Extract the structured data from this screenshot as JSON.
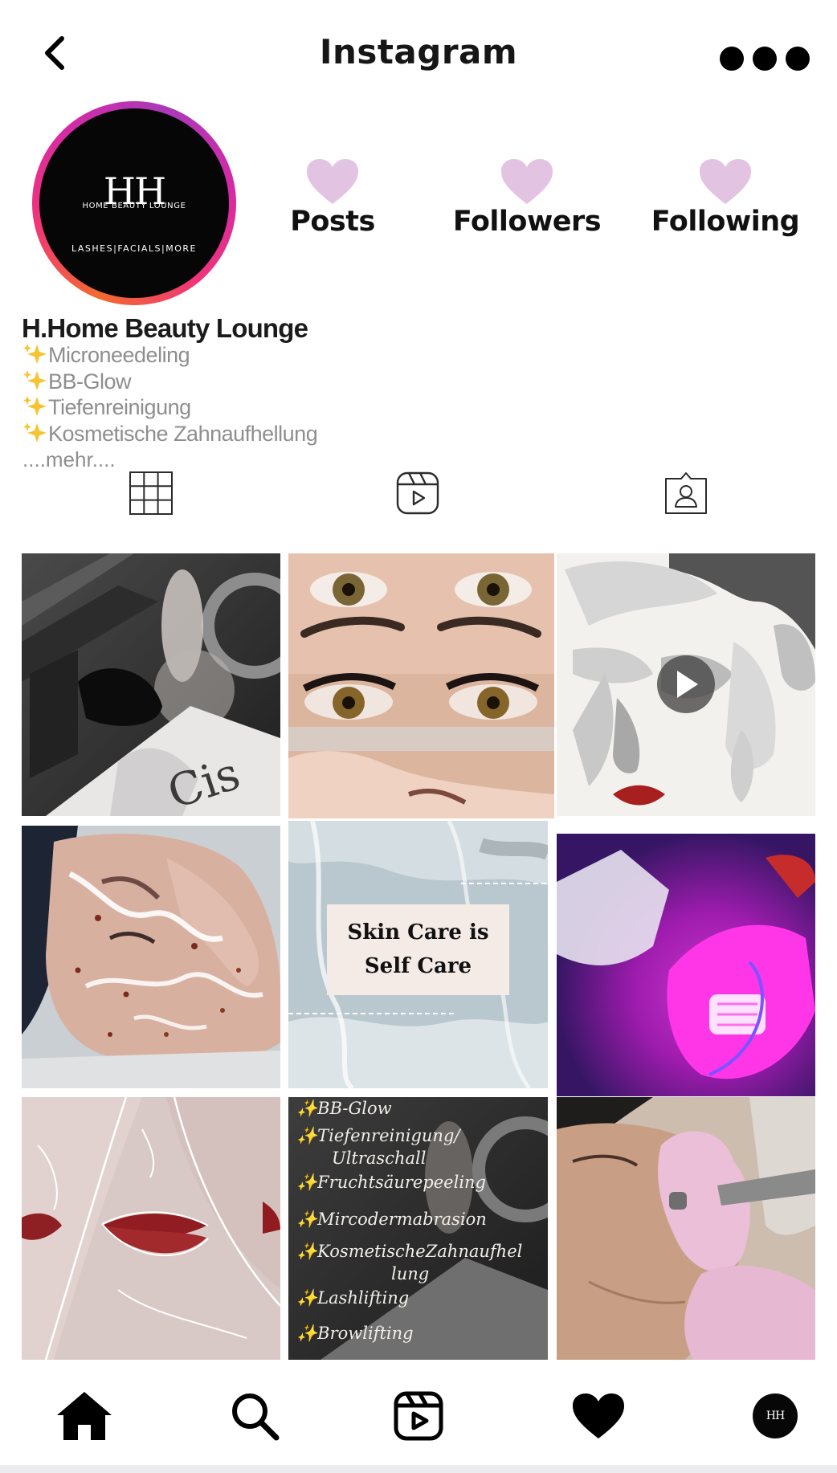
{
  "header": {
    "title": "Instagram",
    "back_icon": "chevron-left-icon",
    "more_icon": "more-dots-icon"
  },
  "profile": {
    "name": "H.Home Beauty Lounge",
    "avatar_logo": {
      "monogram": "HH",
      "line1": "HOME BEAUTY LOUNGE",
      "line2": "LASHES|FACIALS|MORE"
    },
    "stats": [
      {
        "label": "Posts",
        "icon": "heart-icon"
      },
      {
        "label": "Followers",
        "icon": "heart-icon"
      },
      {
        "label": "Following",
        "icon": "heart-icon"
      }
    ],
    "bio": [
      "Microneedeling",
      "BB-Glow",
      "Tiefenreinigung",
      "Kosmetische Zahnaufhellung"
    ],
    "bio_more": "....mehr....",
    "bio_icon": "sparkles-icon"
  },
  "tabs": [
    {
      "name": "grid",
      "icon": "grid-icon"
    },
    {
      "name": "reels",
      "icon": "reels-icon"
    },
    {
      "name": "tagged",
      "icon": "tagged-person-icon"
    }
  ],
  "posts": [
    {
      "type": "photo",
      "subject": "device-steam-treatment"
    },
    {
      "type": "photo",
      "subject": "lash-extension"
    },
    {
      "type": "video",
      "subject": "abstract-face-art",
      "icon": "play-icon"
    },
    {
      "type": "photo",
      "subject": "peel-face-treatment"
    },
    {
      "type": "photo",
      "subject": "skin-care-quote",
      "caption_line1": "Skin Care is",
      "caption_line2": "Self Care"
    },
    {
      "type": "photo",
      "subject": "led-light-therapy"
    },
    {
      "type": "photo",
      "subject": "line-art-lips"
    },
    {
      "type": "photo",
      "subject": "services-list",
      "list": [
        "BB-Glow",
        "Tiefenreinigung/",
        "Ultraschall",
        "Fruchtsäurepeeling",
        "Mircodermabrasion",
        "KosmetischeZahnaufhel",
        "lung",
        "Lashlifting",
        "Browlifting"
      ]
    },
    {
      "type": "photo",
      "subject": "microdermabrasion-treatment"
    }
  ],
  "colors": {
    "heart": "#e2c3e1",
    "bio_text": "#8e8e8e",
    "ring_start": "#f26a2e",
    "ring_end": "#a93ab9",
    "quote_box": "#f4eae6"
  },
  "bottom_nav": [
    {
      "name": "home",
      "icon": "home-icon"
    },
    {
      "name": "search",
      "icon": "search-icon"
    },
    {
      "name": "reels",
      "icon": "reels-icon"
    },
    {
      "name": "activity",
      "icon": "heart-icon"
    },
    {
      "name": "profile",
      "icon": "profile-avatar-icon",
      "monogram": "HH"
    }
  ]
}
